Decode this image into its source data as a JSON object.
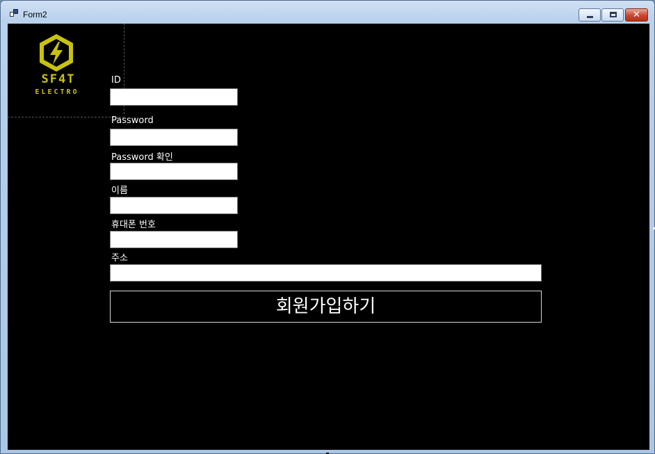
{
  "window": {
    "title": "Form2",
    "controls": {
      "minimize": "minimize",
      "maximize": "maximize",
      "close": "✕"
    }
  },
  "logo": {
    "line1": "SF4T",
    "line2": "ELECTRO",
    "color": "#c8c20f"
  },
  "form": {
    "id_label": "ID",
    "id_value": "",
    "password_label": "Password",
    "password_value": "",
    "password_confirm_label": "Password 확인",
    "password_confirm_value": "",
    "name_label": "이름",
    "name_value": "",
    "phone_label": "휴대폰 번호",
    "phone_value": "",
    "address_label": "주소",
    "address_value": "",
    "submit_label": "회원가입하기"
  }
}
